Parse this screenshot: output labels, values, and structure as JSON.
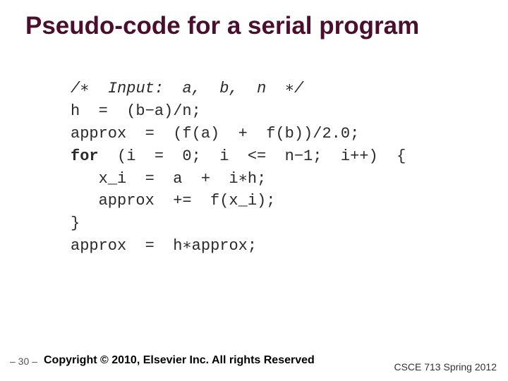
{
  "title": "Pseudo-code for a serial program",
  "code": {
    "l1_a": "/∗  Input:  a,  b,  n  ∗/",
    "l2": "h  =  (b−a)/n;",
    "l3": "approx  =  (f(a)  +  f(b))/2.0;",
    "l4_kw": "for",
    "l4_rest": "  (i  =  0;  i  <=  n−1;  i++)  {",
    "l5": "   x_i  =  a  +  i∗h;",
    "l6": "   approx  +=  f(x_i);",
    "l7": "}",
    "l8": "approx  =  h∗approx;"
  },
  "page_number": "– 30 –",
  "copyright": "Copyright © 2010, Elsevier Inc. All rights Reserved",
  "course": "CSCE 713 Spring 2012"
}
